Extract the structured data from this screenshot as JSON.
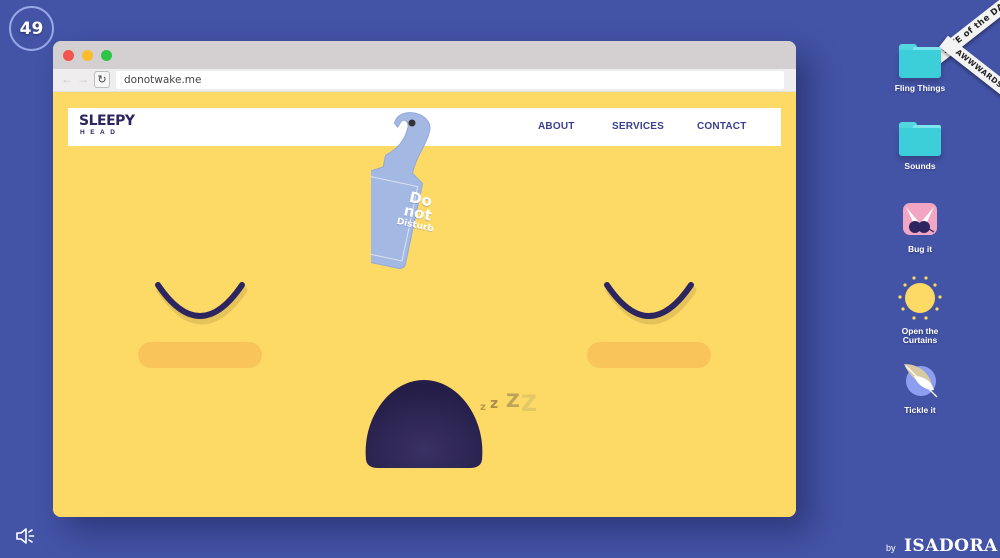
{
  "counter": {
    "value": "49"
  },
  "browser": {
    "url": "donotwake.me",
    "nav_back_icon": "←",
    "nav_forward_icon": "→",
    "reload_icon": "↻"
  },
  "site": {
    "logo_top": "SLEEPY",
    "logo_bottom": "HEAD",
    "menu": [
      {
        "label": "ABOUT"
      },
      {
        "label": "SERVICES"
      },
      {
        "label": "CONTACT"
      }
    ],
    "door_hanger": {
      "line1": "Do",
      "line2": "not",
      "line3": "Disturb"
    },
    "snore": [
      "z",
      "z",
      "Z",
      "Z"
    ]
  },
  "desktop_icons": [
    {
      "label": "Fling Things",
      "icon": "folder-icon"
    },
    {
      "label": "Sounds",
      "icon": "folder-icon"
    },
    {
      "label": "Bug it",
      "icon": "bug-icon"
    },
    {
      "label": "Open the Curtains",
      "icon": "sun-icon"
    },
    {
      "label": "Tickle it",
      "icon": "feather-icon"
    }
  ],
  "awwwards": {
    "top": "SITE of the DAY",
    "bottom": "AWWWARDS"
  },
  "credit": {
    "by": "by",
    "name": "ISADORA"
  },
  "colors": {
    "background": "#4353a6",
    "face": "#fdd966",
    "cheek": "#f9c55a",
    "eye": "#2c2560",
    "mouth": "#2b2350",
    "hanger": "#a4b8e4",
    "nav_text": "#3b3f8f",
    "folder": "#3ccfd9"
  }
}
